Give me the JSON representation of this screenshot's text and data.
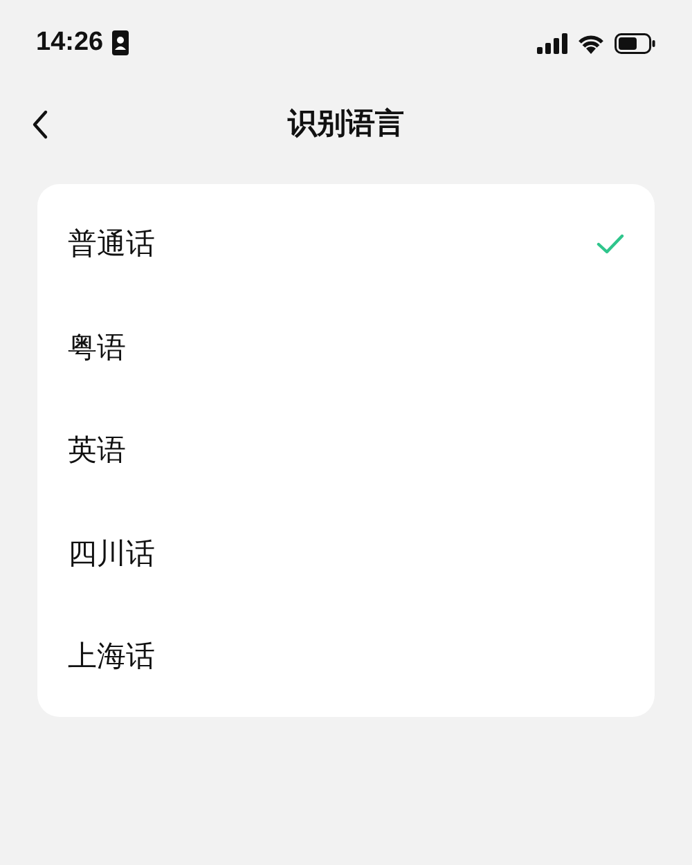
{
  "status_bar": {
    "time": "14:26"
  },
  "header": {
    "title": "识别语言"
  },
  "languages": [
    {
      "label": "普通话",
      "selected": true
    },
    {
      "label": "粤语",
      "selected": false
    },
    {
      "label": "英语",
      "selected": false
    },
    {
      "label": "四川话",
      "selected": false
    },
    {
      "label": "上海话",
      "selected": false
    }
  ]
}
